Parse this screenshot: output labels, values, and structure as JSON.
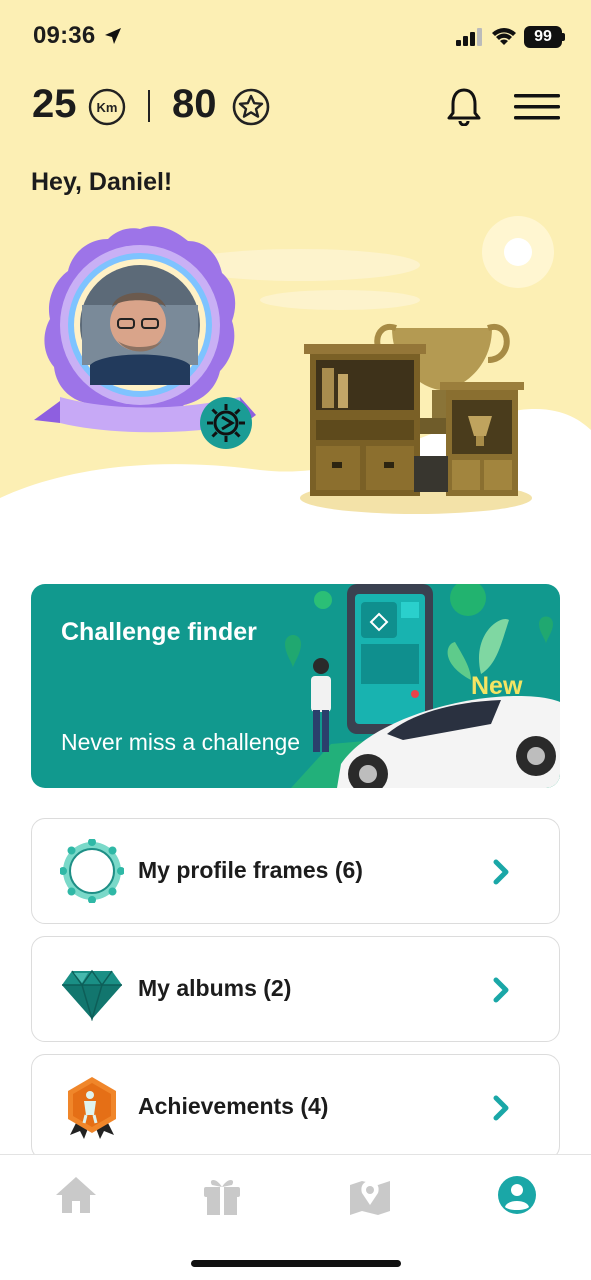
{
  "status_bar": {
    "time": "09:36",
    "battery": "99"
  },
  "stats": {
    "distance_value": "25",
    "distance_unit_icon": "km-icon",
    "points_value": "80",
    "points_icon": "star-icon"
  },
  "greeting": "Hey, Daniel!",
  "banner": {
    "title": "Challenge finder",
    "subtitle": "Never miss a challenge",
    "badge": "New"
  },
  "cards": [
    {
      "label": "My profile frames (6)",
      "icon": "profile-frame-icon"
    },
    {
      "label": "My albums (2)",
      "icon": "diamond-icon"
    },
    {
      "label": "Achievements (4)",
      "icon": "achievement-medal-icon"
    }
  ],
  "tabs": [
    {
      "icon": "home-icon",
      "active": false
    },
    {
      "icon": "gift-icon",
      "active": false
    },
    {
      "icon": "map-icon",
      "active": false
    },
    {
      "icon": "profile-icon",
      "active": true
    }
  ],
  "colors": {
    "hero_background": "#fcefb4",
    "teal_accent": "#11998e",
    "chevron": "#1aa7a7",
    "active_tab": "#1aa7a7",
    "inactive_tab": "#c9c9c9",
    "new_badge": "#f4e463"
  }
}
